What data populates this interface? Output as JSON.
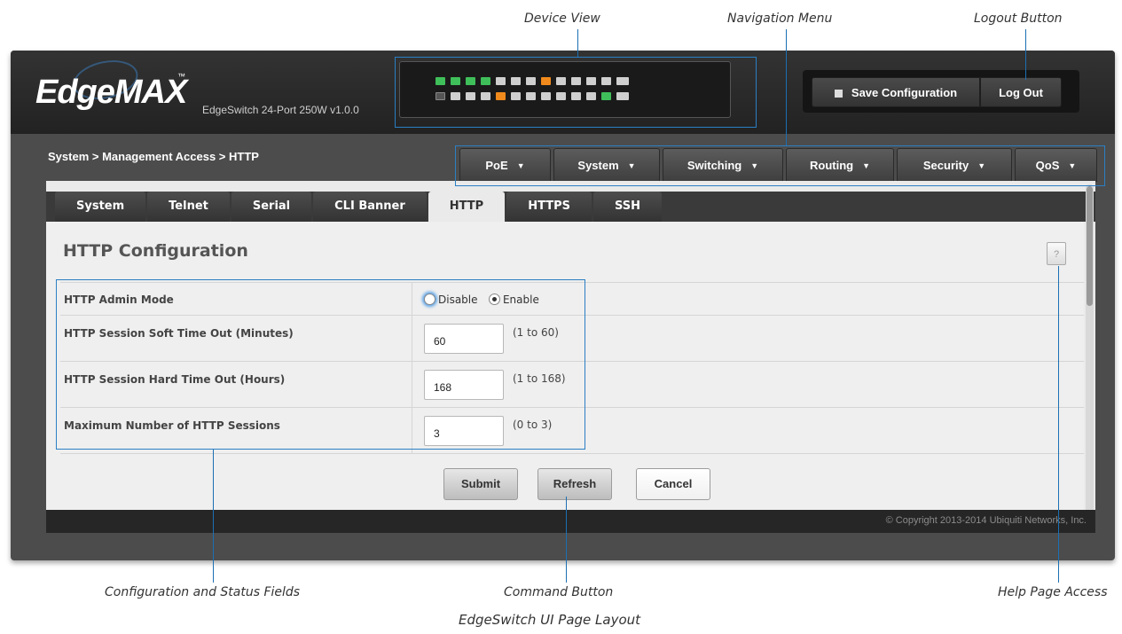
{
  "callouts": {
    "device_view": "Device View",
    "navigation_menu": "Navigation Menu",
    "logout_button": "Logout Button",
    "config_fields": "Configuration and Status Fields",
    "command_button": "Command Button",
    "help_page": "Help Page Access",
    "caption": "EdgeSwitch UI Page Layout"
  },
  "header": {
    "logo": "EdgeMAX",
    "logo_tm": "™",
    "model": "EdgeSwitch 24-Port 250W v1.0.0",
    "save_label": "Save Configuration",
    "logout_label": "Log Out"
  },
  "device_ports": {
    "top_row": [
      "green",
      "green",
      "green",
      "green",
      "gray",
      "gray",
      "gray",
      "orange",
      "gray",
      "gray",
      "gray",
      "gray",
      "gray"
    ],
    "bottom_row": [
      "slash",
      "gray",
      "gray",
      "gray",
      "orange",
      "gray",
      "gray",
      "gray",
      "gray",
      "gray",
      "gray",
      "green",
      "gray"
    ]
  },
  "breadcrumb": "System > Management Access > HTTP",
  "nav": [
    {
      "label": "PoE"
    },
    {
      "label": "System"
    },
    {
      "label": "Switching"
    },
    {
      "label": "Routing"
    },
    {
      "label": "Security"
    },
    {
      "label": "QoS"
    }
  ],
  "subtabs": [
    {
      "label": "System",
      "active": false
    },
    {
      "label": "Telnet",
      "active": false
    },
    {
      "label": "Serial",
      "active": false
    },
    {
      "label": "CLI Banner",
      "active": false
    },
    {
      "label": "HTTP",
      "active": true
    },
    {
      "label": "HTTPS",
      "active": false
    },
    {
      "label": "SSH",
      "active": false
    }
  ],
  "page_title": "HTTP Configuration",
  "help_label": "?",
  "form": {
    "admin_mode": {
      "label": "HTTP Admin Mode",
      "disable_label": "Disable",
      "enable_label": "Enable",
      "selected": "Enable"
    },
    "soft_timeout": {
      "label": "HTTP Session Soft Time Out  (Minutes)",
      "value": "60",
      "range": "(1 to 60)"
    },
    "hard_timeout": {
      "label": "HTTP Session Hard Time Out  (Hours)",
      "value": "168",
      "range": "(1 to 168)"
    },
    "max_sessions": {
      "label": "Maximum Number of HTTP Sessions",
      "value": "3",
      "range": "(0 to 3)"
    }
  },
  "buttons": {
    "submit": "Submit",
    "refresh": "Refresh",
    "cancel": "Cancel"
  },
  "footer": {
    "copyright": "© Copyright 2013-2014 Ubiquiti Networks, Inc."
  },
  "colors": {
    "callout_line": "#2a7fc4",
    "port_green": "#3fbf5a",
    "port_orange": "#f08a1c",
    "port_gray": "#cfcfcf"
  }
}
